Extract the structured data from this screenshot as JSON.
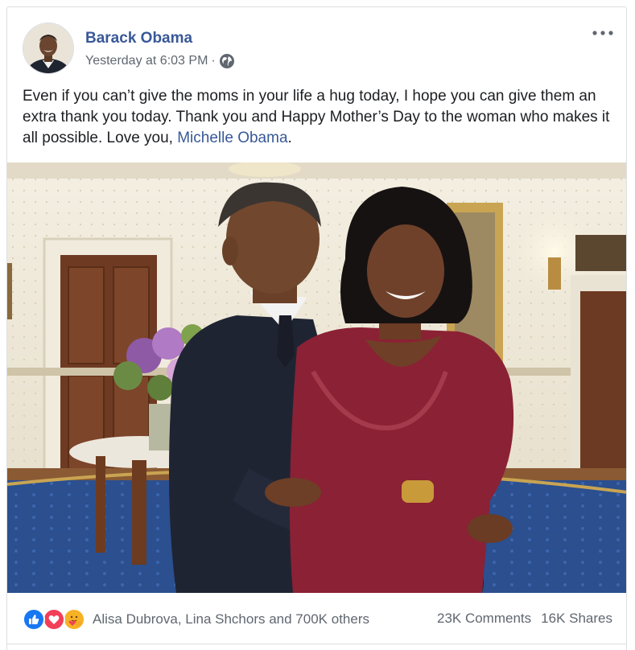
{
  "post": {
    "author": "Barack Obama",
    "timestamp": "Yesterday at 6:03 PM",
    "separator": "·",
    "privacy_icon": "globe-icon",
    "more_icon": "more-options-icon",
    "text_part1": "Even if you can’t give the moms in your life a hug today, I hope you can give them an extra thank you today. Thank you and Happy Mother’s Day to the woman who makes it all possible. Love you, ",
    "mention": "Michelle Obama",
    "text_end": "."
  },
  "engagement": {
    "reaction_icons": [
      "like-icon",
      "love-icon",
      "care-icon"
    ],
    "reactors": "Alisa Dubrova, Lina Shchors and 700K others",
    "comments": "23K Comments",
    "shares": "16K Shares"
  },
  "colors": {
    "link": "#385898",
    "secondary_text": "#606770",
    "like_blue": "#1877f2",
    "love_red": "#f33e58",
    "care_yellow": "#f7b125"
  }
}
